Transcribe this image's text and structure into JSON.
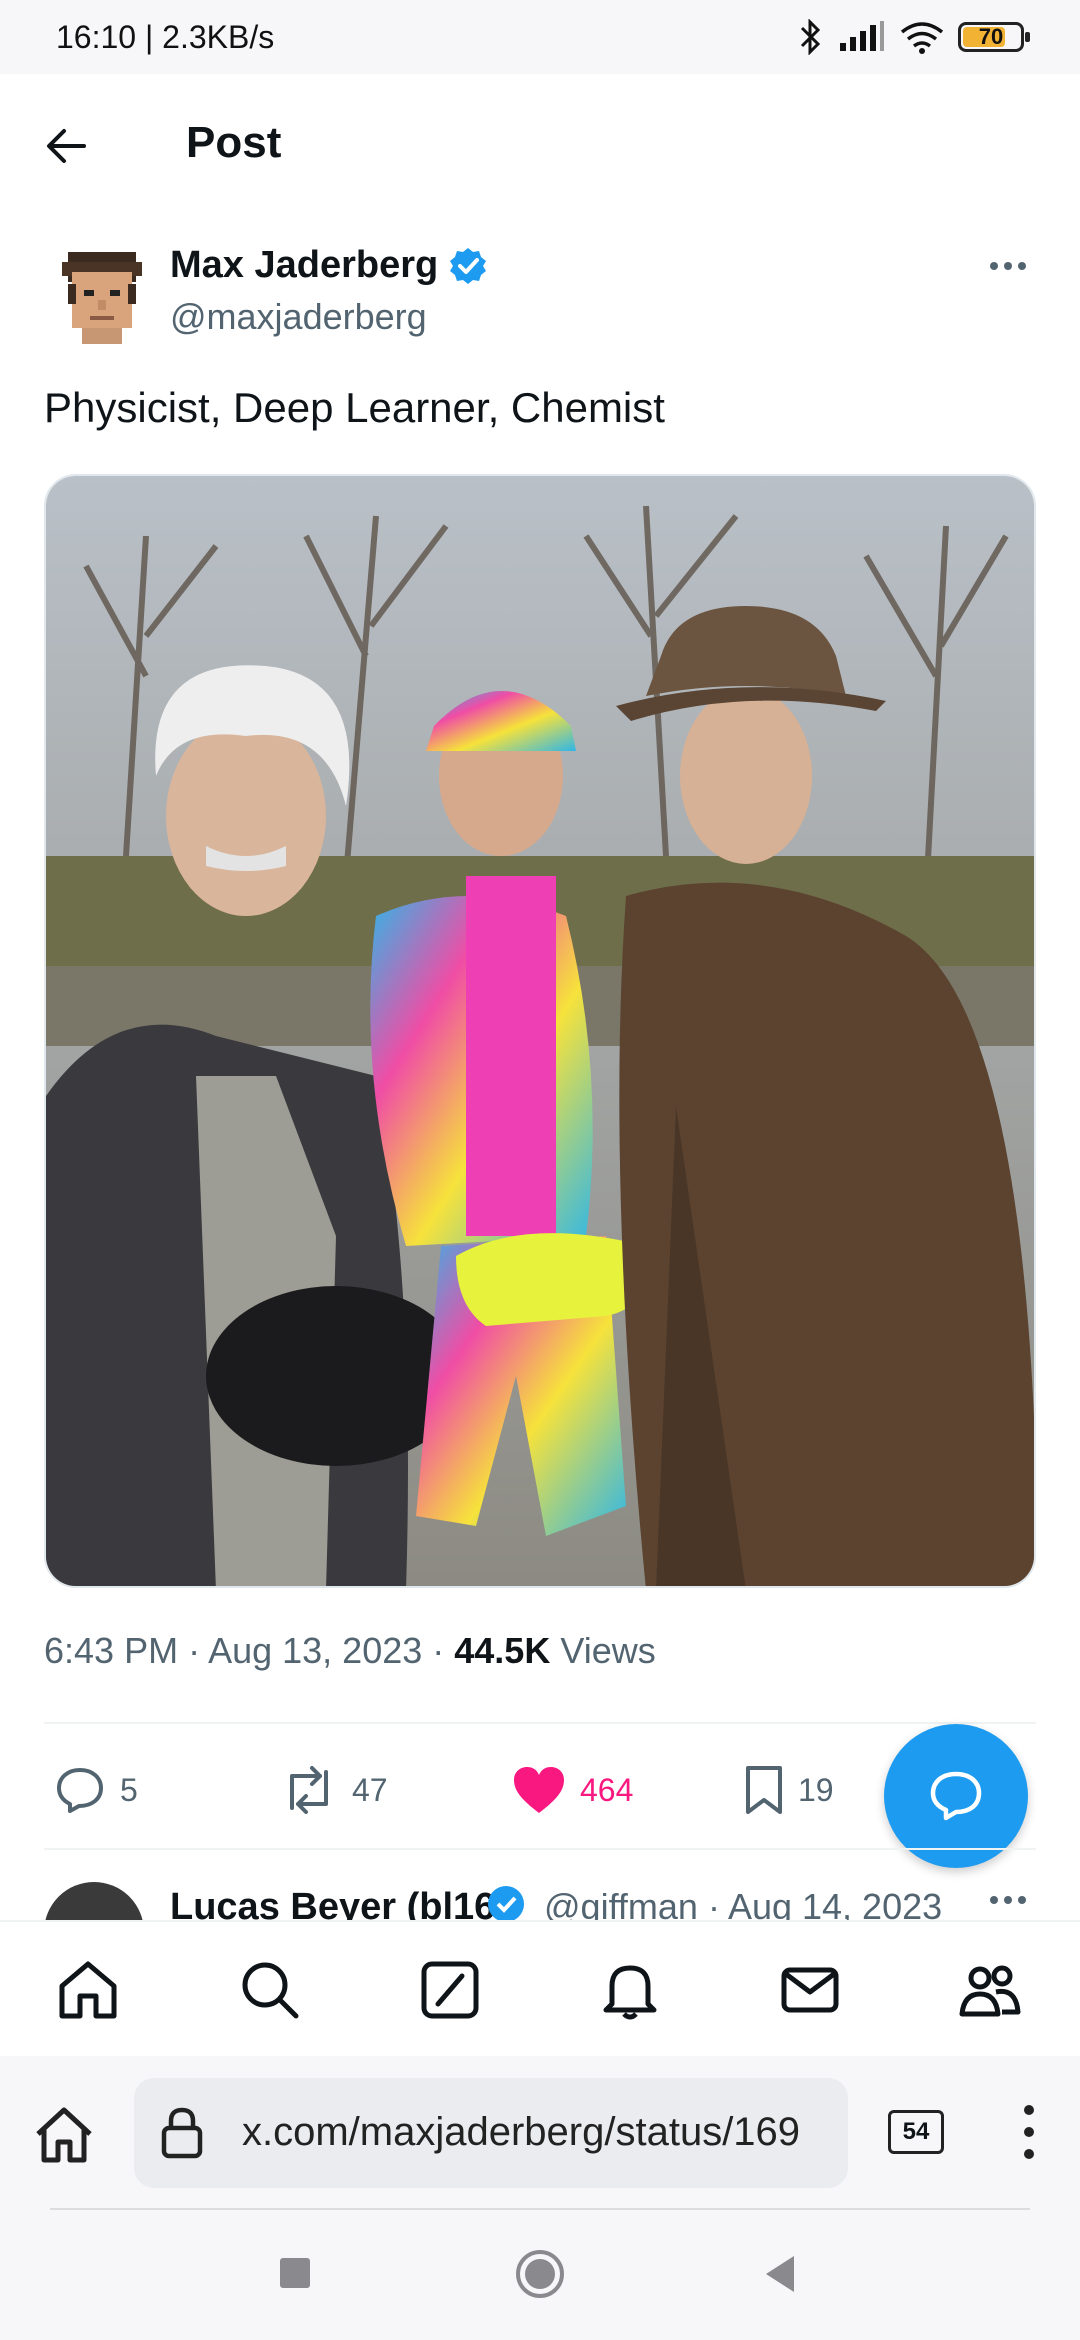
{
  "status_bar": {
    "time": "16:10 | 2.3KB/s",
    "battery": "70"
  },
  "header": {
    "title": "Post"
  },
  "post": {
    "author_name": "Max Jaderberg",
    "author_handle": "@maxjaderberg",
    "text": "Physicist, Deep Learner, Chemist",
    "time": "6:43 PM · Aug 13, 2023 · ",
    "views_count": "44.5K",
    "views_label": " Views",
    "replies": "5",
    "reposts": "47",
    "likes": "464",
    "bookmarks": "19"
  },
  "reply_preview": {
    "name": "Lucas Beyer (bl16",
    "meta": "@giffman · Aug 14, 2023"
  },
  "browser": {
    "url": "x.com/maxjaderberg/status/169",
    "tab_count": "54"
  },
  "colors": {
    "accent": "#1d9bf0",
    "like": "#f91880",
    "battery": "#f2b233"
  }
}
